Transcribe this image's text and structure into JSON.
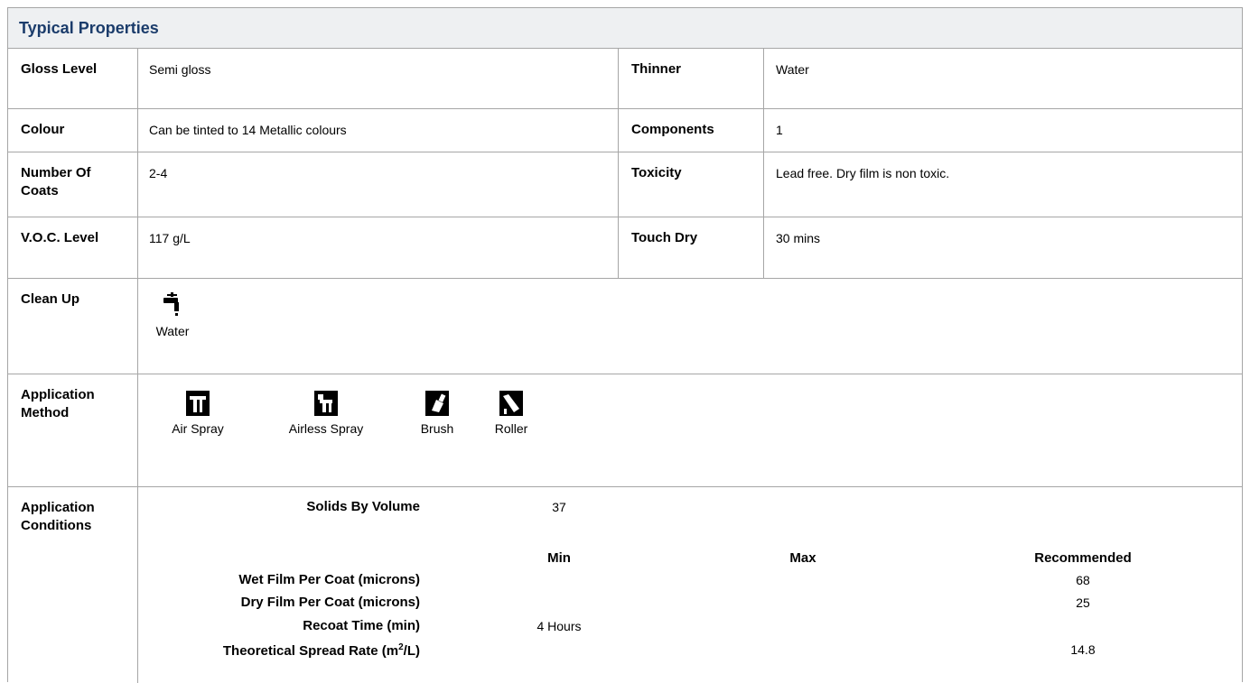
{
  "title": "Typical Properties",
  "rows": [
    {
      "label": "Gloss Level",
      "value": "Semi gloss",
      "label2": "Thinner",
      "value2": "Water"
    },
    {
      "label": "Colour",
      "value": "Can be tinted to 14 Metallic colours",
      "label2": "Components",
      "value2": "1"
    },
    {
      "label": "Number Of Coats",
      "value": "2-4",
      "label2": "Toxicity",
      "value2": "Lead free. Dry film is non toxic."
    },
    {
      "label": "V.O.C. Level",
      "value": "117 g/L",
      "label2": "Touch Dry",
      "value2": "30 mins"
    }
  ],
  "cleanup": {
    "label": "Clean Up",
    "icon": "tap-icon",
    "method": "Water"
  },
  "application_method": {
    "label": "Application Method",
    "methods": [
      {
        "name": "Air Spray",
        "icon": "air-spray-icon"
      },
      {
        "name": "Airless Spray",
        "icon": "airless-spray-icon"
      },
      {
        "name": "Brush",
        "icon": "brush-icon"
      },
      {
        "name": "Roller",
        "icon": "roller-icon"
      }
    ]
  },
  "application_conditions": {
    "label": "Application Conditions",
    "solids_label": "Solids By Volume",
    "solids_value": "37",
    "headers": {
      "min": "Min",
      "max": "Max",
      "recommended": "Recommended"
    },
    "rows": [
      {
        "label": "Wet Film Per Coat (microns)",
        "min": "",
        "max": "",
        "recommended": "68"
      },
      {
        "label": "Dry Film Per Coat (microns)",
        "min": "",
        "max": "",
        "recommended": "25"
      },
      {
        "label": "Recoat Time (min)",
        "min": "4 Hours",
        "max": "",
        "recommended": ""
      },
      {
        "label_prefix": "Theoretical Spread Rate (m",
        "label_sup": "2",
        "label_suffix": "/L)",
        "min": "",
        "max": "",
        "recommended": "14.8"
      }
    ]
  },
  "colors": {
    "title": "#1b3c6b",
    "header_bg": "#eef0f2",
    "border": "#a6a6a6"
  }
}
